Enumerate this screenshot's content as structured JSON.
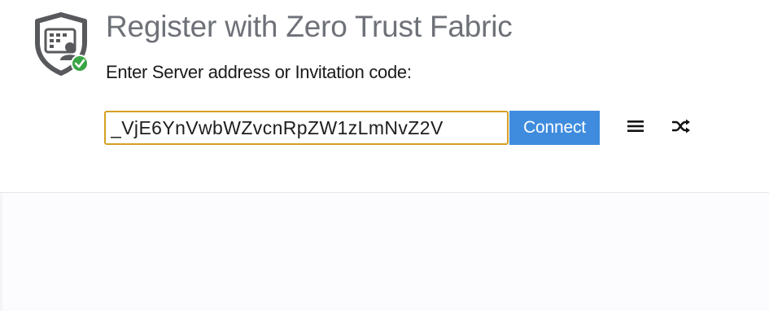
{
  "header": {
    "title": "Register with Zero Trust Fabric",
    "prompt": "Enter Server address or Invitation code:"
  },
  "form": {
    "address_value": "_VjE6YnVwbWZvcnRpZW1zLmNvZ2V",
    "connect_label": "Connect"
  },
  "icons": {
    "app": "shield-server-check-icon",
    "menu": "menu-icon",
    "shuffle": "shuffle-icon"
  },
  "colors": {
    "input_border": "#d6a024",
    "connect_bg": "#3f8cde",
    "check_green": "#3aa545",
    "title_text": "#6e7178"
  }
}
